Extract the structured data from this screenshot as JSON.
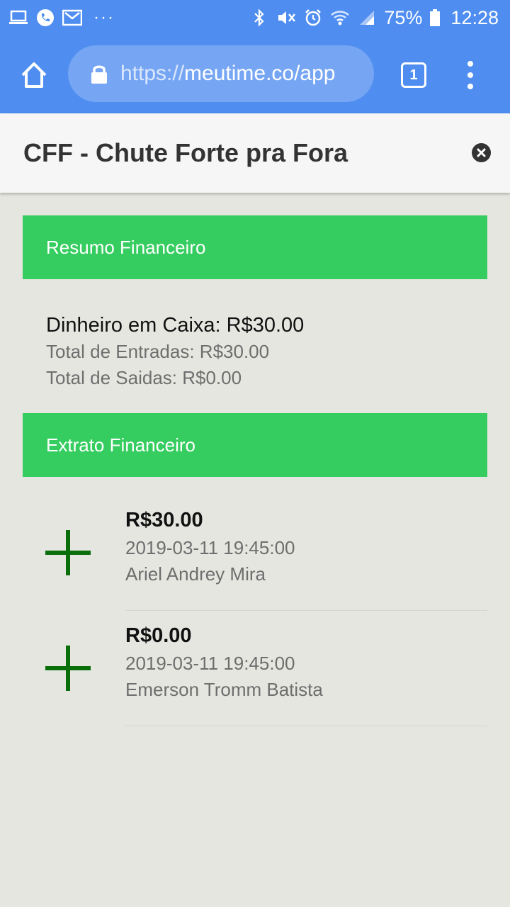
{
  "status_bar": {
    "battery_percent": "75%",
    "time": "12:28",
    "more_dots": "···"
  },
  "browser": {
    "url_scheme": "https://",
    "url_rest": "meutime.co/app",
    "tab_count": "1"
  },
  "header": {
    "title": "CFF - Chute Forte pra Fora"
  },
  "summary_section": {
    "title": "Resumo Financeiro",
    "cash": "Dinheiro em Caixa: R$30.00",
    "total_in": "Total de Entradas: R$30.00",
    "total_out": "Total de Saidas: R$0.00"
  },
  "statement_section": {
    "title": "Extrato Financeiro",
    "entries": [
      {
        "amount": "R$30.00",
        "date": "2019-03-11 19:45:00",
        "name": "Ariel Andrey Mira"
      },
      {
        "amount": "R$0.00",
        "date": "2019-03-11 19:45:00",
        "name": "Emerson Tromm Batista"
      }
    ]
  },
  "colors": {
    "browser_blue": "#4f8ef0",
    "section_green": "#36cd60",
    "plus_green": "#0a6e0a",
    "background": "#e6e6e1"
  }
}
